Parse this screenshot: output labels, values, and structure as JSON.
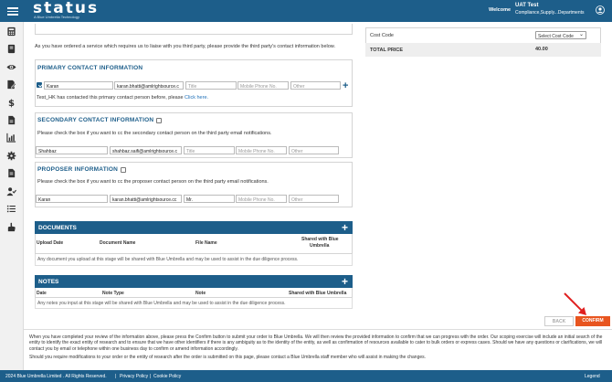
{
  "header": {
    "logo": "status",
    "logo_sub": "A Blue Umbrella Technology",
    "welcome": "Welcome",
    "user_name": "UAT Test",
    "user_role": "Compliance,Supply...Departments"
  },
  "sidebar": {
    "icons": [
      "calculator-icon",
      "book-icon",
      "eye-icon",
      "edit-document-icon",
      "dollar-icon",
      "document-icon",
      "bar-chart-icon",
      "gear-icon",
      "file-icon",
      "user-check-icon",
      "list-icon",
      "hand-icon"
    ]
  },
  "intro_text": "As you have ordered a service which requires us to liaise with you third party, please provide the third party's contact information below.",
  "primary": {
    "title": "PRIMARY CONTACT INFORMATION",
    "checked": true,
    "first_name": "Karan",
    "email": "karan.bhatti@amlrightsource.c",
    "title_placeholder": "Title",
    "phone_placeholder": "Mobile Phone No.",
    "other_placeholder": "Other",
    "note_prefix": "Test_HK has contacted this primary contact person before, please",
    "note_link": "Click here."
  },
  "secondary": {
    "title": "SECONDARY CONTACT INFORMATION",
    "instruction": "Please check the box if you want to cc the secondary contact person on the third party email notifications.",
    "first_name": "Shahbaz",
    "email": "shahbaz.saifi@amlrightsource.c",
    "title_placeholder": "Title",
    "phone_placeholder": "Mobile Phone No.",
    "other_placeholder": "Other"
  },
  "proposer": {
    "title": "PROPOSER INFORMATION",
    "instruction": "Please check the box if you want to cc the proposer contact person on the third party email notifications.",
    "first_name": "Karan",
    "email": "karan.bhatti@amlrightsource.cc",
    "title_value": "Mr.",
    "phone_placeholder": "Mobile Phone No.",
    "other_placeholder": "Other"
  },
  "documents": {
    "title": "DOCUMENTS",
    "columns": [
      "Upload Date",
      "Document Name",
      "File Name",
      "Shared with Blue",
      "Umbrella"
    ],
    "note": "Any document you upload at this stage will be shared with Blue Umbrella and may be used to assist in the due diligence process."
  },
  "notes": {
    "title": "NOTES",
    "columns": [
      "Date",
      "Note Type",
      "Note",
      "Shared with Blue Umbrella"
    ],
    "note": "Any notes you input at this stage will be shared with Blue Umbrella and may be used to assist in the due diligence process."
  },
  "order_summary": {
    "cost_code_label": "Cost Code",
    "cost_code_select": "Select Cost Code",
    "total_label": "TOTAL PRICE",
    "total_value": "40.00"
  },
  "buttons": {
    "back": "BACK",
    "confirm": "CONFIRM"
  },
  "info": {
    "paragraph1": "When you have completed your review of the information above, please press the Confirm button to submit your order to Blue Umbrella. We will then review the provided information to confirm that we can progress with the order. Our scoping exercise will include an initial search of the entity to identify the exact entity of research and to ensure that we have other identifiers if there is any ambiguity as to the identity of the entity, as well as confirmation of resources available to cater to bulk orders or express cases. Should we have any questions or clarifications, we will contact you by email or telephone within one business day to confirm or amend information accordingly.",
    "paragraph2": "Should you require modifications to your order or the entity of research after the order is submitted on this page, please contact a Blue Umbrella staff member who will assist in making the changes."
  },
  "footer": {
    "copyright": "2024 Blue Umbrella Limited . All Rights Reserved.",
    "privacy": "Privacy Policy",
    "cookie": "Cookie Policy",
    "legend": "Legend"
  },
  "colors": {
    "brand": "#1d5e8a",
    "confirm": "#e8551f",
    "arrow": "#e02020"
  }
}
